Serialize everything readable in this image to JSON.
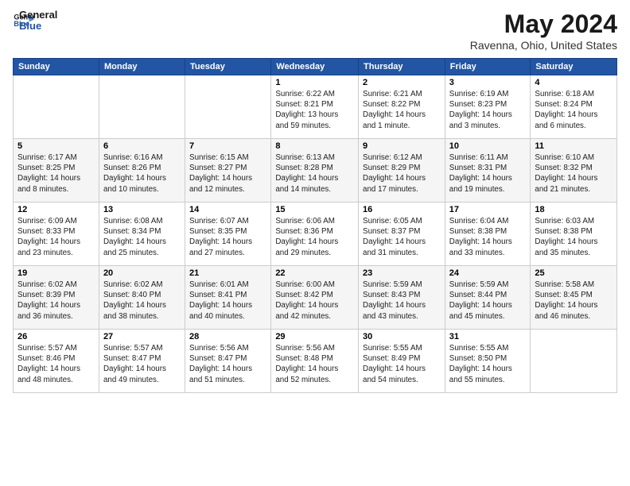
{
  "logo": {
    "line1": "General",
    "line2": "Blue"
  },
  "title": "May 2024",
  "subtitle": "Ravenna, Ohio, United States",
  "days_of_week": [
    "Sunday",
    "Monday",
    "Tuesday",
    "Wednesday",
    "Thursday",
    "Friday",
    "Saturday"
  ],
  "weeks": [
    [
      {
        "day": "",
        "info": ""
      },
      {
        "day": "",
        "info": ""
      },
      {
        "day": "",
        "info": ""
      },
      {
        "day": "1",
        "info": "Sunrise: 6:22 AM\nSunset: 8:21 PM\nDaylight: 13 hours\nand 59 minutes."
      },
      {
        "day": "2",
        "info": "Sunrise: 6:21 AM\nSunset: 8:22 PM\nDaylight: 14 hours\nand 1 minute."
      },
      {
        "day": "3",
        "info": "Sunrise: 6:19 AM\nSunset: 8:23 PM\nDaylight: 14 hours\nand 3 minutes."
      },
      {
        "day": "4",
        "info": "Sunrise: 6:18 AM\nSunset: 8:24 PM\nDaylight: 14 hours\nand 6 minutes."
      }
    ],
    [
      {
        "day": "5",
        "info": "Sunrise: 6:17 AM\nSunset: 8:25 PM\nDaylight: 14 hours\nand 8 minutes."
      },
      {
        "day": "6",
        "info": "Sunrise: 6:16 AM\nSunset: 8:26 PM\nDaylight: 14 hours\nand 10 minutes."
      },
      {
        "day": "7",
        "info": "Sunrise: 6:15 AM\nSunset: 8:27 PM\nDaylight: 14 hours\nand 12 minutes."
      },
      {
        "day": "8",
        "info": "Sunrise: 6:13 AM\nSunset: 8:28 PM\nDaylight: 14 hours\nand 14 minutes."
      },
      {
        "day": "9",
        "info": "Sunrise: 6:12 AM\nSunset: 8:29 PM\nDaylight: 14 hours\nand 17 minutes."
      },
      {
        "day": "10",
        "info": "Sunrise: 6:11 AM\nSunset: 8:31 PM\nDaylight: 14 hours\nand 19 minutes."
      },
      {
        "day": "11",
        "info": "Sunrise: 6:10 AM\nSunset: 8:32 PM\nDaylight: 14 hours\nand 21 minutes."
      }
    ],
    [
      {
        "day": "12",
        "info": "Sunrise: 6:09 AM\nSunset: 8:33 PM\nDaylight: 14 hours\nand 23 minutes."
      },
      {
        "day": "13",
        "info": "Sunrise: 6:08 AM\nSunset: 8:34 PM\nDaylight: 14 hours\nand 25 minutes."
      },
      {
        "day": "14",
        "info": "Sunrise: 6:07 AM\nSunset: 8:35 PM\nDaylight: 14 hours\nand 27 minutes."
      },
      {
        "day": "15",
        "info": "Sunrise: 6:06 AM\nSunset: 8:36 PM\nDaylight: 14 hours\nand 29 minutes."
      },
      {
        "day": "16",
        "info": "Sunrise: 6:05 AM\nSunset: 8:37 PM\nDaylight: 14 hours\nand 31 minutes."
      },
      {
        "day": "17",
        "info": "Sunrise: 6:04 AM\nSunset: 8:38 PM\nDaylight: 14 hours\nand 33 minutes."
      },
      {
        "day": "18",
        "info": "Sunrise: 6:03 AM\nSunset: 8:38 PM\nDaylight: 14 hours\nand 35 minutes."
      }
    ],
    [
      {
        "day": "19",
        "info": "Sunrise: 6:02 AM\nSunset: 8:39 PM\nDaylight: 14 hours\nand 36 minutes."
      },
      {
        "day": "20",
        "info": "Sunrise: 6:02 AM\nSunset: 8:40 PM\nDaylight: 14 hours\nand 38 minutes."
      },
      {
        "day": "21",
        "info": "Sunrise: 6:01 AM\nSunset: 8:41 PM\nDaylight: 14 hours\nand 40 minutes."
      },
      {
        "day": "22",
        "info": "Sunrise: 6:00 AM\nSunset: 8:42 PM\nDaylight: 14 hours\nand 42 minutes."
      },
      {
        "day": "23",
        "info": "Sunrise: 5:59 AM\nSunset: 8:43 PM\nDaylight: 14 hours\nand 43 minutes."
      },
      {
        "day": "24",
        "info": "Sunrise: 5:59 AM\nSunset: 8:44 PM\nDaylight: 14 hours\nand 45 minutes."
      },
      {
        "day": "25",
        "info": "Sunrise: 5:58 AM\nSunset: 8:45 PM\nDaylight: 14 hours\nand 46 minutes."
      }
    ],
    [
      {
        "day": "26",
        "info": "Sunrise: 5:57 AM\nSunset: 8:46 PM\nDaylight: 14 hours\nand 48 minutes."
      },
      {
        "day": "27",
        "info": "Sunrise: 5:57 AM\nSunset: 8:47 PM\nDaylight: 14 hours\nand 49 minutes."
      },
      {
        "day": "28",
        "info": "Sunrise: 5:56 AM\nSunset: 8:47 PM\nDaylight: 14 hours\nand 51 minutes."
      },
      {
        "day": "29",
        "info": "Sunrise: 5:56 AM\nSunset: 8:48 PM\nDaylight: 14 hours\nand 52 minutes."
      },
      {
        "day": "30",
        "info": "Sunrise: 5:55 AM\nSunset: 8:49 PM\nDaylight: 14 hours\nand 54 minutes."
      },
      {
        "day": "31",
        "info": "Sunrise: 5:55 AM\nSunset: 8:50 PM\nDaylight: 14 hours\nand 55 minutes."
      },
      {
        "day": "",
        "info": ""
      }
    ]
  ]
}
